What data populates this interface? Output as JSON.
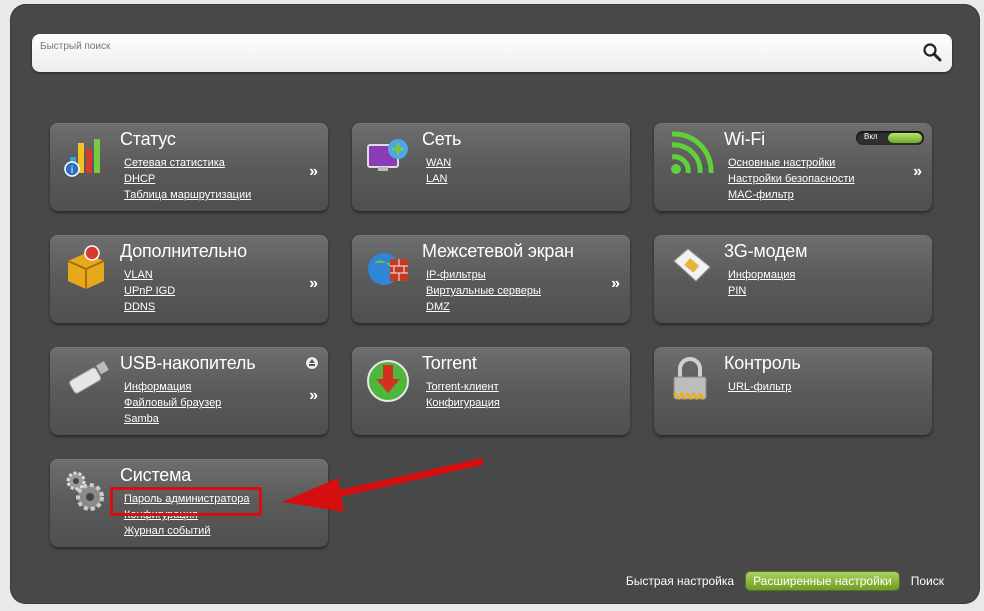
{
  "search": {
    "placeholder": "Быстрый поиск"
  },
  "tiles": {
    "status": {
      "title": "Статус",
      "links": [
        "Сетевая статистика",
        "DHCP",
        "Таблица маршрутизации"
      ]
    },
    "network": {
      "title": "Сеть",
      "links": [
        "WAN",
        "LAN"
      ]
    },
    "wifi": {
      "title": "Wi-Fi",
      "toggle_label": "Вкл",
      "links": [
        "Основные настройки",
        "Настройки безопасности",
        "MAC-фильтр"
      ]
    },
    "advanced": {
      "title": "Дополнительно",
      "links": [
        "VLAN",
        "UPnP IGD",
        "DDNS"
      ]
    },
    "firewall": {
      "title": "Межсетевой экран",
      "links": [
        "IP-фильтры",
        "Виртуальные серверы",
        "DMZ"
      ]
    },
    "modem3g": {
      "title": "3G-модем",
      "links": [
        "Информация",
        "PIN"
      ]
    },
    "usb": {
      "title": "USB-накопитель",
      "links": [
        "Информация",
        "Файловый браузер",
        "Samba"
      ]
    },
    "torrent": {
      "title": "Torrent",
      "links": [
        "Torrent-клиент",
        "Конфигурация"
      ]
    },
    "control": {
      "title": "Контроль",
      "links": [
        "URL-фильтр"
      ]
    },
    "system": {
      "title": "Система",
      "links": [
        "Пароль администратора",
        "Конфигурация",
        "Журнал событий"
      ]
    }
  },
  "more_glyph": "»",
  "footer": {
    "quick_setup": "Быстрая настройка",
    "advanced_settings": "Расширенные настройки",
    "search": "Поиск"
  },
  "colors": {
    "accent_green": "#8cbf3f",
    "highlight_red": "#d50f0f"
  }
}
